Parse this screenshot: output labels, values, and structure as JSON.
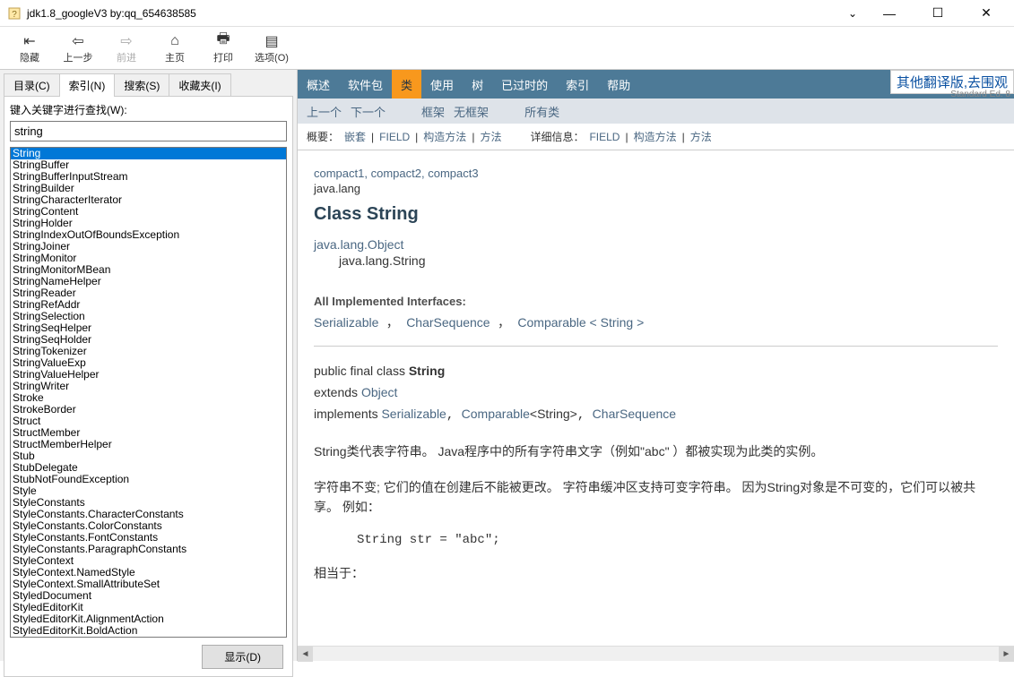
{
  "window": {
    "title": "jdk1.8_googleV3 by:qq_654638585"
  },
  "toolbar": {
    "hide": "隐藏",
    "back": "上一步",
    "forward": "前进",
    "home": "主页",
    "print": "打印",
    "options": "选项(O)"
  },
  "tabs": {
    "contents": "目录(C)",
    "index": "索引(N)",
    "search": "搜索(S)",
    "favorites": "收藏夹(I)"
  },
  "sidebar": {
    "search_label": "键入关键字进行查找(W):",
    "search_value": "string",
    "show_button": "显示(D)",
    "results": [
      "String",
      "StringBuffer",
      "StringBufferInputStream",
      "StringBuilder",
      "StringCharacterIterator",
      "StringContent",
      "StringHolder",
      "StringIndexOutOfBoundsException",
      "StringJoiner",
      "StringMonitor",
      "StringMonitorMBean",
      "StringNameHelper",
      "StringReader",
      "StringRefAddr",
      "StringSelection",
      "StringSeqHelper",
      "StringSeqHolder",
      "StringTokenizer",
      "StringValueExp",
      "StringValueHelper",
      "StringWriter",
      "Stroke",
      "StrokeBorder",
      "Struct",
      "StructMember",
      "StructMemberHelper",
      "Stub",
      "StubDelegate",
      "StubNotFoundException",
      "Style",
      "StyleConstants",
      "StyleConstants.CharacterConstants",
      "StyleConstants.ColorConstants",
      "StyleConstants.FontConstants",
      "StyleConstants.ParagraphConstants",
      "StyleContext",
      "StyleContext.NamedStyle",
      "StyleContext.SmallAttributeSet",
      "StyledDocument",
      "StyledEditorKit",
      "StyledEditorKit.AlignmentAction",
      "StyledEditorKit.BoldAction"
    ]
  },
  "doc_nav1": {
    "items": [
      "概述",
      "软件包",
      "类",
      "使用",
      "树",
      "已过时的",
      "索引",
      "帮助"
    ],
    "top_right": "其他翻译版,去围观",
    "top_right_sub": "Standard Ed. 8"
  },
  "doc_nav2": {
    "prev": "上一个",
    "next": "下一个",
    "frames": "框架",
    "noframes": "无框架",
    "allclasses": "所有类"
  },
  "doc_nav3": {
    "summary_label": "概要：",
    "nested": "嵌套",
    "field": "FIELD",
    "constr": "构造方法",
    "method": "方法",
    "detail_label": "详细信息：",
    "d_field": "FIELD",
    "d_constr": "构造方法",
    "d_method": "方法"
  },
  "content": {
    "compacts": [
      "compact1",
      "compact2",
      "compact3"
    ],
    "package": "java.lang",
    "class_title": "Class String",
    "inherit_top": "java.lang.Object",
    "inherit_self": "java.lang.String",
    "impl_label": "All Implemented Interfaces:",
    "impl_items": [
      "Serializable",
      "CharSequence",
      "Comparable < String >"
    ],
    "sig_prefix": "public final class ",
    "sig_name": "String",
    "sig_extends": "extends ",
    "sig_object": "Object",
    "sig_impl": "implements ",
    "sig_i1": "Serializable",
    "sig_i2": "Comparable",
    "sig_i2_param": "<String>",
    "sig_i3": "CharSequence",
    "desc1": "String类代表字符串。 Java程序中的所有字符串文字（例如\"abc\" ）都被实现为此类的实例。",
    "desc2": "字符串不变; 它们的值在创建后不能被更改。 字符串缓冲区支持可变字符串。 因为String对象是不可变的，它们可以被共享。 例如：",
    "code1": "String str = \"abc\";",
    "desc3": "相当于："
  }
}
